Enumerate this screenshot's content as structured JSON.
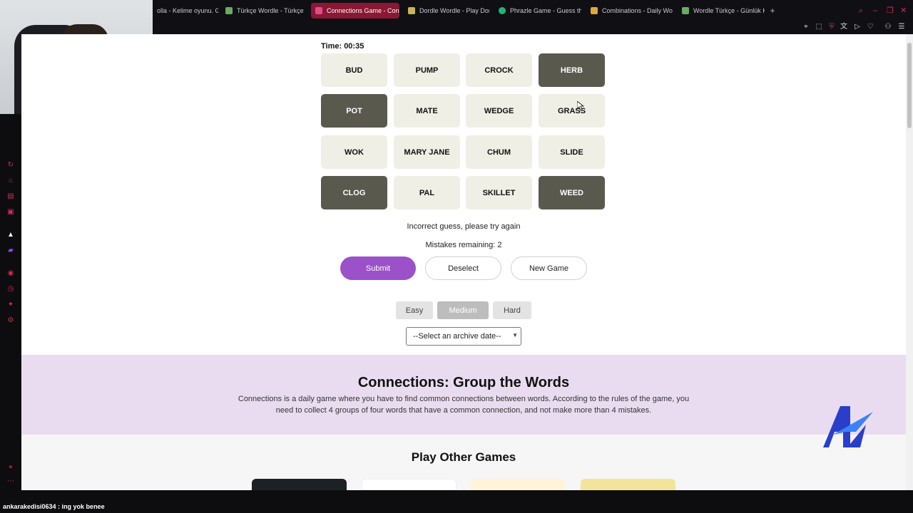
{
  "browser": {
    "tabs": [
      {
        "label": "olla - Kelime oyunu. G",
        "color": "#ffffff"
      },
      {
        "label": "Türkçe Wordle - Türkçe K",
        "color": "#6aaa64"
      },
      {
        "label": "Connections Game - Con",
        "color": "#ffffff",
        "active": true
      },
      {
        "label": "Dordle Wordle - Play Don",
        "color": "#c9b458"
      },
      {
        "label": "Phrazle Game - Guess th",
        "color": "#21b573"
      },
      {
        "label": "Combinations - Daily Wo",
        "color": "#e0a83a"
      },
      {
        "label": "Wordle Türkçe - Günlük K",
        "color": "#6aaa64"
      }
    ],
    "new_tab": "+"
  },
  "game": {
    "timer": "Time: 00:35",
    "tiles": [
      {
        "word": "BUD",
        "selected": false
      },
      {
        "word": "PUMP",
        "selected": false
      },
      {
        "word": "CROCK",
        "selected": false
      },
      {
        "word": "HERB",
        "selected": true
      },
      {
        "word": "POT",
        "selected": true
      },
      {
        "word": "MATE",
        "selected": false
      },
      {
        "word": "WEDGE",
        "selected": false
      },
      {
        "word": "GRASS",
        "selected": false
      },
      {
        "word": "WOK",
        "selected": false
      },
      {
        "word": "MARY JANE",
        "selected": false
      },
      {
        "word": "CHUM",
        "selected": false
      },
      {
        "word": "SLIDE",
        "selected": false
      },
      {
        "word": "CLOG",
        "selected": true
      },
      {
        "word": "PAL",
        "selected": false
      },
      {
        "word": "SKILLET",
        "selected": false
      },
      {
        "word": "WEED",
        "selected": true
      }
    ],
    "feedback": "Incorrect guess, please try again",
    "mistakes": "Mistakes remaining: 2",
    "buttons": {
      "submit": "Submit",
      "deselect": "Deselect",
      "new_game": "New Game"
    },
    "difficulty": {
      "easy": "Easy",
      "medium": "Medium",
      "hard": "Hard",
      "selected": "Medium"
    },
    "archive_select": "--Select an archive date--"
  },
  "info": {
    "title": "Connections: Group the Words",
    "text": "Connections is a daily game where you have to find common connections between words. According to the rules of the game, you need to collect 4 groups of four words that have a common connection, and not make more than 4 mistakes."
  },
  "other_games": {
    "title": "Play Other Games"
  },
  "chat": {
    "line": "ankarakedisi0634 : ing yok benee"
  },
  "colors": {
    "accent": "#9b51c8",
    "tile": "#efefe6",
    "tile_selected": "#5a594e",
    "info_bg": "#e9dcf0",
    "browser_accent": "#d8294d"
  }
}
